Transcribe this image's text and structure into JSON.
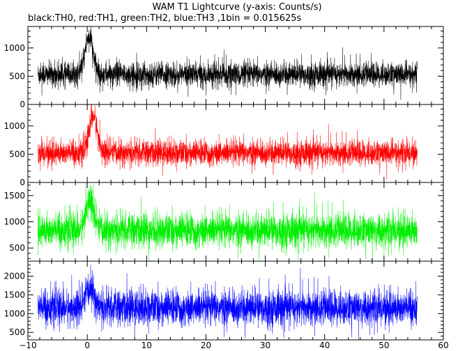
{
  "chart_data": {
    "type": "line",
    "title": "WAM T1 Lightcurve (y-axis: Counts/s)",
    "subtitle": "black:TH0, red:TH1, green:TH2, blue:TH3 ,1bin = 0.015625s",
    "bin_width_s": 0.015625,
    "x_range": [
      -10,
      60
    ],
    "x_data_range": [
      -8.3,
      55.6
    ],
    "x_ticks": [
      -10,
      0,
      10,
      20,
      30,
      40,
      50,
      60
    ],
    "x_tick_labels": [
      "−10",
      "0",
      "10",
      "20",
      "30",
      "40",
      "50",
      "60"
    ],
    "panels": [
      {
        "name": "TH0",
        "color": "#000000",
        "ylim": [
          0,
          1380
        ],
        "y_ticks": [
          0,
          500,
          1000
        ],
        "y_tick_labels": [
          "0",
          "500",
          "1000"
        ],
        "baseline_mean": 530,
        "noise_amplitude": 190,
        "peak": {
          "x": 0.3,
          "y": 1400
        }
      },
      {
        "name": "TH1",
        "color": "#ff0000",
        "ylim": [
          0,
          1380
        ],
        "y_ticks": [
          0,
          500,
          1000
        ],
        "y_tick_labels": [
          "0",
          "500",
          "1000"
        ],
        "baseline_mean": 520,
        "noise_amplitude": 200,
        "peak": {
          "x": 1.0,
          "y": 1380
        }
      },
      {
        "name": "TH2",
        "color": "#00ee00",
        "ylim": [
          250,
          1750
        ],
        "y_ticks": [
          500,
          1000,
          1500
        ],
        "y_tick_labels": [
          "500",
          "1000",
          "1500"
        ],
        "baseline_mean": 830,
        "noise_amplitude": 290,
        "peak": {
          "x": 0.4,
          "y": 1700
        }
      },
      {
        "name": "TH3",
        "color": "#0000ff",
        "ylim": [
          300,
          2400
        ],
        "y_ticks": [
          500,
          1000,
          1500,
          2000
        ],
        "y_tick_labels": [
          "500",
          "1000",
          "1500",
          "2000"
        ],
        "baseline_mean": 1150,
        "noise_amplitude": 420,
        "peak": {
          "x": 0.5,
          "y": 2100
        }
      }
    ]
  }
}
